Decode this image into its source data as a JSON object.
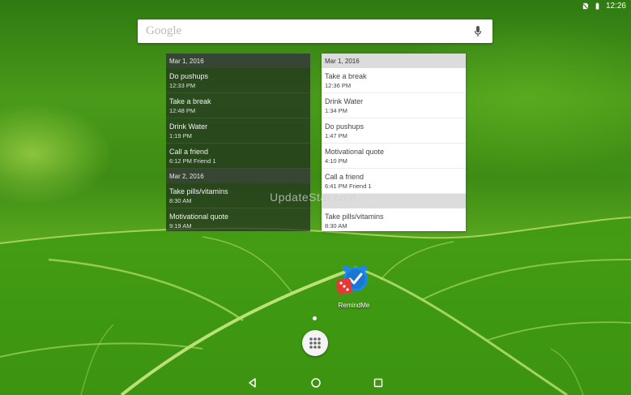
{
  "status_bar": {
    "time": "12:26"
  },
  "search": {
    "placeholder": "Google"
  },
  "widget_dark": {
    "rows": [
      {
        "kind": "header",
        "title": "Mar 1, 2016"
      },
      {
        "kind": "item",
        "title": "Do pushups",
        "subtitle": "12:33 PM"
      },
      {
        "kind": "item",
        "title": "Take a break",
        "subtitle": "12:48 PM"
      },
      {
        "kind": "item",
        "title": "Drink Water",
        "subtitle": "1:19 PM"
      },
      {
        "kind": "item",
        "title": "Call a friend",
        "subtitle": "6:12 PM  Friend 1"
      },
      {
        "kind": "header",
        "title": "Mar 2, 2016"
      },
      {
        "kind": "item",
        "title": "Take pills/vitamins",
        "subtitle": "8:30 AM"
      },
      {
        "kind": "item",
        "title": "Motivational quote",
        "subtitle": "9:19 AM"
      }
    ]
  },
  "widget_light": {
    "rows": [
      {
        "kind": "header",
        "title": "Mar 1, 2016"
      },
      {
        "kind": "item",
        "title": "Take a break",
        "subtitle": "12:36 PM"
      },
      {
        "kind": "item",
        "title": "Drink Water",
        "subtitle": "1:34 PM"
      },
      {
        "kind": "item",
        "title": "Do pushups",
        "subtitle": "1:47 PM"
      },
      {
        "kind": "item",
        "title": "Motivational quote",
        "subtitle": "4:10 PM"
      },
      {
        "kind": "item",
        "title": "Call a friend",
        "subtitle": "6:41 PM  Friend 1"
      },
      {
        "kind": "header",
        "title": ""
      },
      {
        "kind": "item",
        "title": "Take pills/vitamins",
        "subtitle": "8:30 AM"
      }
    ]
  },
  "watermark": "UpdateStar.com",
  "app": {
    "label": "RemindMe"
  },
  "colors": {
    "accent_blue": "#1e88e5",
    "dice_red": "#e53935"
  }
}
